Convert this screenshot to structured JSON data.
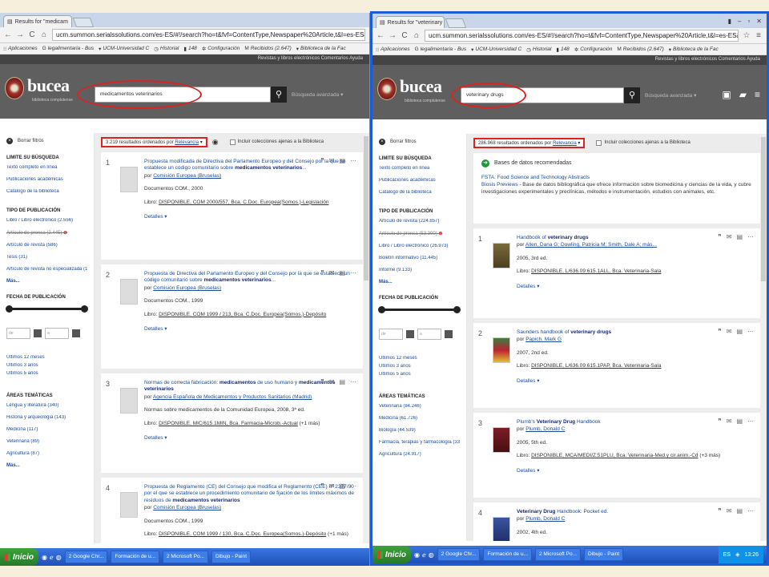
{
  "left": {
    "tab_title": "Results for \"medicam",
    "url": "ucm.summon.serialssolutions.com/es-ES/#!/search?ho=t&fvf=ContentType,Newspaper%20Article,t&l=es-ES&q=medicamentos%20",
    "search_query": "medicamentos veterinarios",
    "results_count_text": "3.219 resultados ordenados por",
    "sort_label": "Relevancia",
    "include_label": "Incluir colecciones ajenas a la Biblioteca",
    "sidebar": {
      "clear": "Borrar filtros",
      "limit_heading": "LIMITE SU BÚSQUEDA",
      "limit_items": [
        "Texto completo en línea",
        "Publicaciones académicas",
        "Catálogo de la biblioteca"
      ],
      "type_heading": "TIPO DE PUBLICACIÓN",
      "type_items": [
        "Libro / Libro electrónico (2.556)",
        "Artículo de prensa (2.445)",
        "Artículo de revista (586)",
        "Tesis (31)",
        "Artículo de revista no especializada (16)"
      ],
      "more": "Más...",
      "date_heading": "FECHA DE PUBLICACIÓN",
      "date_from": "de",
      "date_to": "a",
      "date_items": [
        "Últimos 12 meses",
        "Últimos 3 años",
        "Últimos 5 años"
      ],
      "areas_heading": "ÁREAS TEMÁTICAS",
      "areas_items": [
        "Lengua y literatura (340)",
        "Historia y arqueología (143)",
        "Medicina (117)",
        "Veterinaria (89)",
        "Agricultura (87)"
      ],
      "more2": "Más..."
    },
    "results": [
      {
        "num": "1",
        "title_pre": "Propuesta modificada de Directiva del Parlamento Europeo y del Consejo por la que se establece un código comunitario sobre ",
        "title_bold": "medicamentos veterinarios",
        "by": "por",
        "author": "Comisión Europea (Bruselas)",
        "meta": "Documentos COM., 2000",
        "line_pre": "Libro: ",
        "line_u": "DISPONIBLE, COM 2000/557, Bca. C.Doc. Europea(Somos.)-Legislación",
        "details": "Detalles ▾"
      },
      {
        "num": "2",
        "title_pre": "Propuesta de Directiva del Parlamento Europeo y del Consejo por la que se establece un código comunitario sobre ",
        "title_bold": "medicamentos veterinarios",
        "by": "por",
        "author": "Comisión Europea (Bruselas)",
        "meta": "Documentos COM., 1999",
        "line_pre": "Libro: ",
        "line_u": "DISPONIBLE, COM 1999 / 213, Bca. C.Doc. Europea(Somos.)-Depósito",
        "details": "Detalles ▾"
      },
      {
        "num": "3",
        "title_pre": "Normas de correcta fabricación: ",
        "title_bold": "medicamentos",
        "title_mid": " de uso humano y ",
        "title_bold2": "medicamentos veterinarios",
        "by": "por",
        "author": "Agencia Española de Medicamentos y Productos Sanitarios (Madrid)",
        "meta": "Normas sobre medicamentos de la Comunidad Europea, 2008, 3ª ed.",
        "line_pre": "Libro: ",
        "line_u": "DISPONIBLE, MIC/615.1MIN, Bca. Farmacia-Microb.-Actual",
        "line_post": " (+1 más)",
        "details": "Detalles ▾"
      },
      {
        "num": "4",
        "title_pre": "Propuesta de Reglamento (CE) del Consejo que modifica el Reglamento (CEE) nº 2377/90 por el que se establece un procedimiento comunitario de fijación de los límites máximos de residuos de ",
        "title_bold": "medicamentos veterinarios",
        "by": "por",
        "author": "Comisión Europea (Bruselas)",
        "meta": "Documentos COM., 1999",
        "line_pre": "Libro: ",
        "line_u": "DISPONIBLE, COM 1999 / 130, Bca. C.Doc. Europea(Somos.)-Depósito",
        "line_post": " (+1 más)"
      }
    ]
  },
  "right": {
    "tab_title": "Results for \"veterinary",
    "url": "ucm.summon.serialssolutions.com/es-ES/#!/search?ho=t&fvf=ContentType,Newspaper%20Article,t&l=es-ES&q=veterinary%20drugs&pg=buscador",
    "search_query": "veterinary drugs",
    "results_count_text": "286.968 resultados ordenados por",
    "sort_label": "Relevancia",
    "include_label": "Incluir colecciones ajenas a la Biblioteca",
    "top_links": "Revistas y libros electrónicos   Comentarios   Ayuda",
    "sidebar": {
      "clear": "Borrar filtros",
      "limit_heading": "LIMITE SU BÚSQUEDA",
      "limit_items": [
        "Texto completo en línea",
        "Publicaciones académicas",
        "Catálogo de la biblioteca"
      ],
      "type_heading": "TIPO DE PUBLICACIÓN",
      "type_items": [
        "Artículo de revista (224.857)",
        "Artículo de prensa (53.300)",
        "Libro / Libro electrónico (26.973)",
        "Boletín informativo (11.445)",
        "Informe (9.133)"
      ],
      "more": "Más...",
      "date_heading": "FECHA DE PUBLICACIÓN",
      "date_from": "de",
      "date_to": "a",
      "date_items": [
        "Últimos 12 meses",
        "Últimos 3 años",
        "Últimos 5 años"
      ],
      "areas_heading": "ÁREAS TEMÁTICAS",
      "areas_items": [
        "Veterinaria (84.246)",
        "Medicina (61.726)",
        "Biología (44.539)",
        "Farmacia, terapias y farmacología (33.221)",
        "Agricultura (24.917)"
      ]
    },
    "rec": {
      "heading": "Bases de datos recomendadas",
      "db1": "FSTA: Food Science and Technology Abstracts",
      "db2_name": "Biosis Previews",
      "db2_desc": " - Base de datos bibliográfica que ofrece información sobre biomedicina y ciencias de la vida, y cubre investigaciones experimentales y preclínicas, métodos e instrumentación, estudios con animales, etc."
    },
    "results": [
      {
        "num": "1",
        "title_pre": "Handbook of ",
        "title_bold": "veterinary drugs",
        "by": "por",
        "author": "Allen, Dana G; Dowling, Patricia M; Smith, Dale A; más...",
        "meta": "2005, 3rd ed.",
        "line_pre": "Libro: ",
        "line_u": "DISPONIBLE, L/636.09:615.1ALL, Bca. Veterinaria-Sala",
        "details": "Detalles ▾"
      },
      {
        "num": "2",
        "title_pre": "Saunders handbook of ",
        "title_bold": "veterinary drugs",
        "by": "por",
        "author": "Papich, Mark G",
        "meta": "2007, 2nd ed.",
        "line_pre": "Libro: ",
        "line_u": "DISPONIBLE, L/636.09:615.1PAP, Bca. Veterinaria-Sala",
        "details": "Detalles ▾"
      },
      {
        "num": "3",
        "title_pre": "Plumb's ",
        "title_bold": "Veterinary Drug",
        "title_post": " Handbook",
        "by": "por",
        "author": "Plumb, Donald C",
        "meta": "2005, 5th ed.",
        "line_pre": "Libro: ",
        "line_u": "DISPONIBLE, MCA/MEDI/Z:51PLU, Bca. Veterinaria-Med.y cir.anim.-Cd",
        "line_post": " (+3 más)",
        "details": "Detalles ▾"
      },
      {
        "num": "4",
        "title_pre": "",
        "title_bold": "Veterinary Drug",
        "title_post": " Handbook: Pocket ed.",
        "by": "por",
        "author": "Plumb, Donald C",
        "meta": "2002, 4th ed."
      }
    ]
  },
  "chrome": {
    "bookmarks": [
      "Aplicaciones",
      "legalimentaria - Bus",
      "UCM-Universidad C",
      "Historial",
      "148",
      "Configuración",
      "Recibidos (2.647)",
      "Biblioteca de la Fac"
    ],
    "advanced_search": "Búsqueda avanzada ▾",
    "logo": "bucea",
    "logo_sub": "biblioteca complutense"
  },
  "taskbar": {
    "start": "Inicio",
    "left_buttons": [
      "2 Google Chr...",
      "Formación de u...",
      "2 Microsoft Po...",
      "Dibujo - Paint"
    ],
    "right_buttons": [
      "2 Google Chr...",
      "Formación de u...",
      "2 Microsoft Po...",
      "Dibujo - Paint"
    ],
    "tray_lang": "ES",
    "clock": "13:26"
  }
}
